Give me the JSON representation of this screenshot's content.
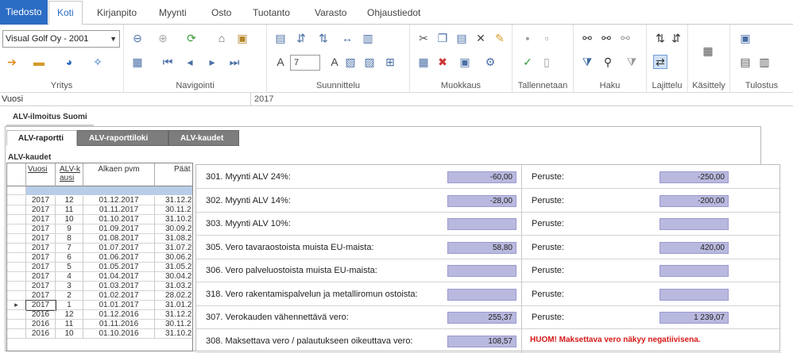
{
  "menu": {
    "file": "Tiedosto",
    "tabs": [
      "Koti",
      "Kirjanpito",
      "Myynti",
      "Osto",
      "Tuotanto",
      "Varasto",
      "Ohjaustiedot"
    ]
  },
  "ribbon": {
    "company": "Visual Golf Oy - 2001",
    "font_size": "7",
    "groups": [
      "Yritys",
      "Navigointi",
      "Suunnittelu",
      "Muokkaus",
      "Tallennetaan",
      "Haku",
      "Lajittelu",
      "Käsittely",
      "Tulostus"
    ]
  },
  "yearbar": {
    "label": "Vuosi",
    "value": "2017"
  },
  "page_tab": "ALV-ilmoitus Suomi",
  "subtabs": [
    "ALV-raportti",
    "ALV-raporttiloki",
    "ALV-kaudet"
  ],
  "kaudet_label": "ALV-kaudet",
  "grid": {
    "headers": [
      "Vuosi",
      "ALV-kausi",
      "Alkaen pvm",
      "Päät"
    ],
    "rows": [
      [
        "2017",
        "12",
        "01.12.2017",
        "31.12.2"
      ],
      [
        "2017",
        "11",
        "01.11.2017",
        "30.11.2"
      ],
      [
        "2017",
        "10",
        "01.10.2017",
        "31.10.2"
      ],
      [
        "2017",
        "9",
        "01.09.2017",
        "30.09.2"
      ],
      [
        "2017",
        "8",
        "01.08.2017",
        "31.08.2"
      ],
      [
        "2017",
        "7",
        "01.07.2017",
        "31.07.2"
      ],
      [
        "2017",
        "6",
        "01.06.2017",
        "30.06.2"
      ],
      [
        "2017",
        "5",
        "01.05.2017",
        "31.05.2"
      ],
      [
        "2017",
        "4",
        "01.04.2017",
        "30.04.2"
      ],
      [
        "2017",
        "3",
        "01.03.2017",
        "31.03.2"
      ],
      [
        "2017",
        "2",
        "01.02.2017",
        "28.02.2"
      ],
      [
        "2017",
        "1",
        "01.01.2017",
        "31.01.2"
      ],
      [
        "2016",
        "12",
        "01.12.2016",
        "31.12.2"
      ],
      [
        "2016",
        "11",
        "01.11.2016",
        "30.11.2"
      ],
      [
        "2016",
        "10",
        "01.10.2016",
        "31.10.2"
      ]
    ]
  },
  "form": {
    "rows": [
      {
        "label": "301. Myynti ALV 24%:",
        "value": "-60,00",
        "plabel": "Peruste:",
        "pvalue": "-250,00"
      },
      {
        "label": "302. Myynti ALV 14%:",
        "value": "-28,00",
        "plabel": "Peruste:",
        "pvalue": "-200,00"
      },
      {
        "label": "303. Myynti ALV 10%:",
        "value": "",
        "plabel": "Peruste:",
        "pvalue": ""
      },
      {
        "label": "305. Vero tavaraostoista muista EU-maista:",
        "value": "58,80",
        "plabel": "Peruste:",
        "pvalue": "420,00"
      },
      {
        "label": "306. Vero palveluostoista muista EU-maista:",
        "value": "",
        "plabel": "Peruste:",
        "pvalue": ""
      },
      {
        "label": "318. Vero rakentamispalvelun ja metalliromun ostoista:",
        "value": "",
        "plabel": "Peruste:",
        "pvalue": ""
      },
      {
        "label": "307. Verokauden vähennettävä vero:",
        "value": "255,37",
        "plabel": "Peruste:",
        "pvalue": "1 239,07"
      },
      {
        "label": "308. Maksettava vero / palautukseen oikeuttava vero:",
        "value": "108,57",
        "plabel": "",
        "pvalue": ""
      }
    ],
    "warning": "HUOM! Maksettava vero näkyy negatiivisena."
  }
}
